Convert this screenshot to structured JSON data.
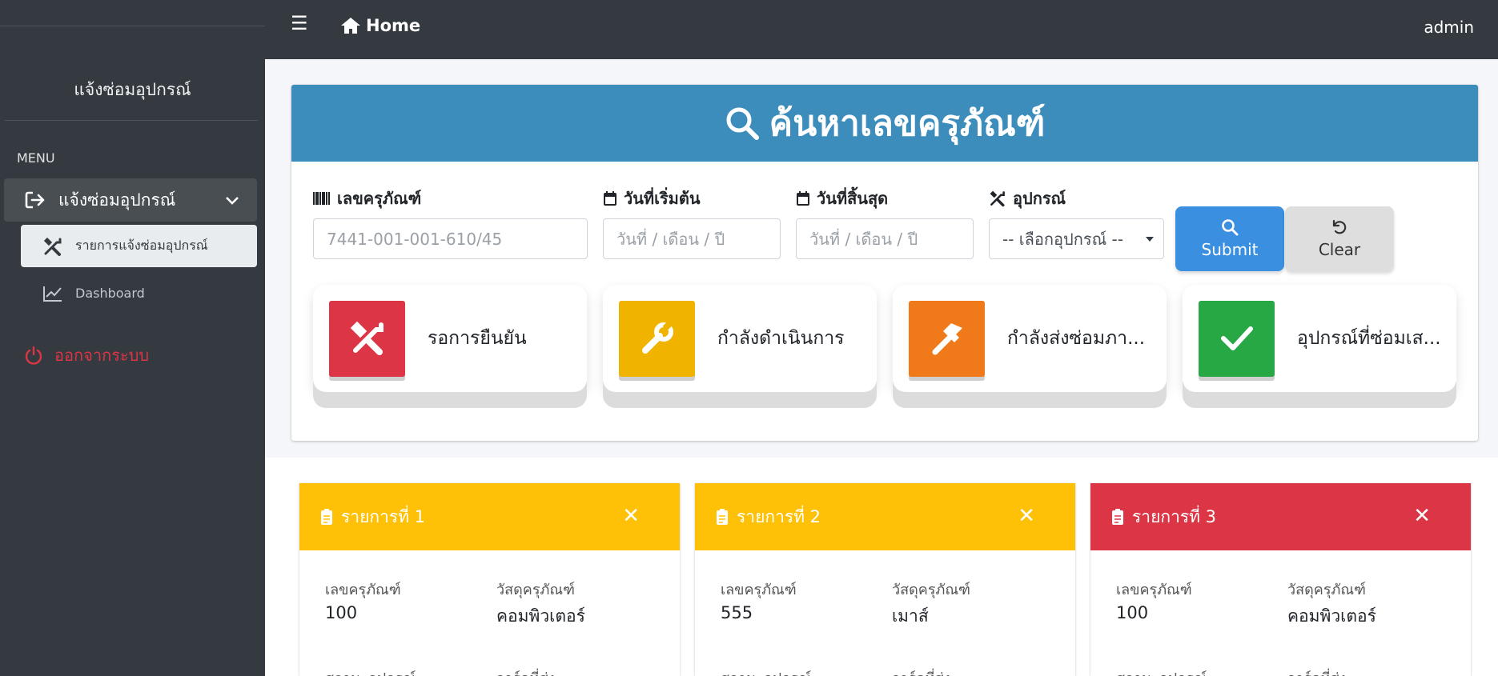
{
  "sidebar": {
    "brand": "แจ้งซ่อมอุปกรณ์",
    "menu_header": "MENU",
    "parent_item": "แจ้งซ่อมอุปกรณ์",
    "child_items": [
      "รายการแจ้งซ่อมอุปกรณ์",
      "Dashboard"
    ],
    "logout": "ออกจากระบบ"
  },
  "navbar": {
    "menu_icon": "☰",
    "home": "Home",
    "user": "admin"
  },
  "search": {
    "title": "ค้นหาเลขครุภัณฑ์",
    "fields": {
      "asset_label": "เลขครุภัณฑ์",
      "asset_placeholder": "7441-001-001-610/45",
      "start_label": "วันที่เริ่มต้น",
      "start_placeholder": "วันที่ / เดือน / ปี",
      "end_label": "วันที่สิ้นสุด",
      "end_placeholder": "วันที่ / เดือน / ปี",
      "device_label": "อุปกรณ์",
      "device_selected": "-- เลือกอุปกรณ์ --"
    },
    "submit": "Submit",
    "clear": "Clear"
  },
  "status_cards": [
    {
      "label": "รอการยืนยัน",
      "color": "#dc3545",
      "icon": "tools-icon"
    },
    {
      "label": "กำลังดำเนินการ",
      "color": "#f0b400",
      "icon": "wrench-icon"
    },
    {
      "label": "กำลังส่งซ่อมภา...",
      "color": "#f07a1a",
      "icon": "hammer-icon"
    },
    {
      "label": "อุปกรณ์ที่ซ่อมเส...",
      "color": "#28a745",
      "icon": "check-icon"
    }
  ],
  "items": [
    {
      "title": "รายการที่ 1",
      "color": "#ffc107",
      "asset_label": "เลขครุภัณฑ์",
      "asset_value": "100",
      "material_label": "วัสดุครุภัณฑ์",
      "material_value": "คอมพิวเตอร์",
      "cut_left": "สถานะอุปกรณ์",
      "cut_right": "วาร์ดที่ส่ง"
    },
    {
      "title": "รายการที่ 2",
      "color": "#ffc107",
      "asset_label": "เลขครุภัณฑ์",
      "asset_value": "555",
      "material_label": "วัสดุครุภัณฑ์",
      "material_value": "เมาส์",
      "cut_left": "สถานะอุปกรณ์",
      "cut_right": "วาร์ดที่ส่ง"
    },
    {
      "title": "รายการที่ 3",
      "color": "#dc3545",
      "asset_label": "เลขครุภัณฑ์",
      "asset_value": "100",
      "material_label": "วัสดุครุภัณฑ์",
      "material_value": "คอมพิวเตอร์",
      "cut_left": "สถานะอุปกรณ์",
      "cut_right": "วาร์ดที่ส่ง"
    }
  ],
  "close_symbol": "✕"
}
